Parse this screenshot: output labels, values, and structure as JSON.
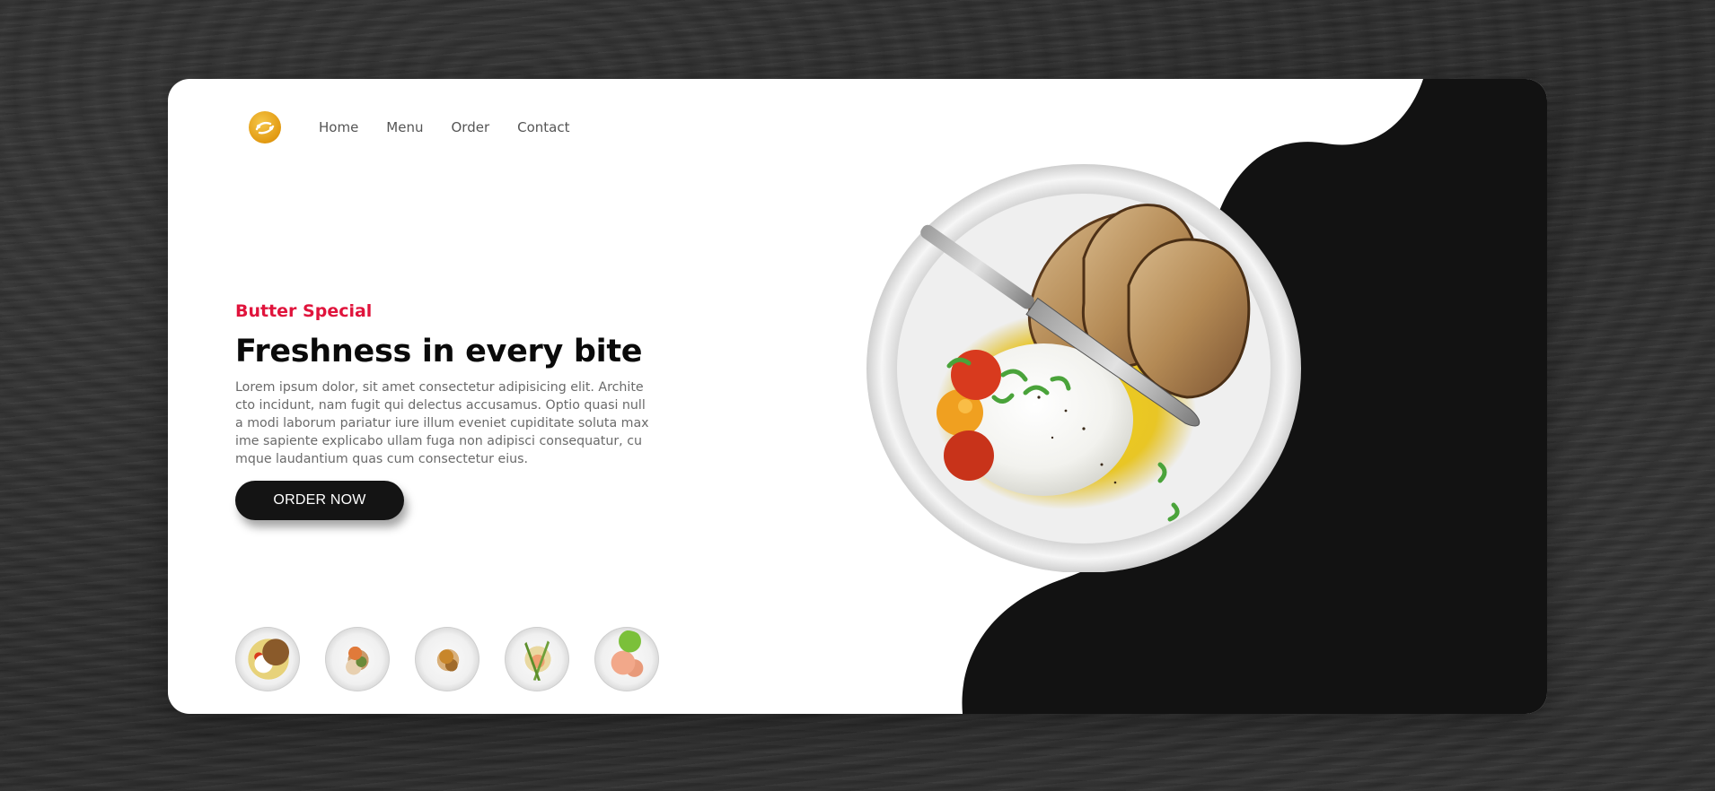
{
  "brand": {
    "logo_icon": "fork-spoon-logo-icon",
    "accent_color": "#e0143c",
    "logo_color": "#f0b21f",
    "dark_color": "#121212"
  },
  "nav": {
    "items": [
      {
        "label": "Home"
      },
      {
        "label": "Menu"
      },
      {
        "label": "Order"
      },
      {
        "label": "Contact"
      }
    ]
  },
  "hero": {
    "eyebrow": "Butter Special",
    "headline": "Freshness in every bite",
    "body": "Lorem ipsum dolor, sit amet consectetur adipisicing elit. Architecto incidunt, nam fugit qui delectus accusamus. Optio quasi nulla modi laborum pariatur iure illum eveniet cupiditate soluta maxime sapiente explicabo ullam fuga non adipisci consequatur, cumque laudantium quas cum consectetur eius.",
    "cta_label": "ORDER NOW"
  },
  "thumbnails": [
    {
      "name": "burrata-toast-thumbnail"
    },
    {
      "name": "seafood-plate-thumbnail"
    },
    {
      "name": "pasta-plate-thumbnail"
    },
    {
      "name": "salmon-asparagus-thumbnail"
    },
    {
      "name": "salmon-salad-thumbnail"
    }
  ]
}
